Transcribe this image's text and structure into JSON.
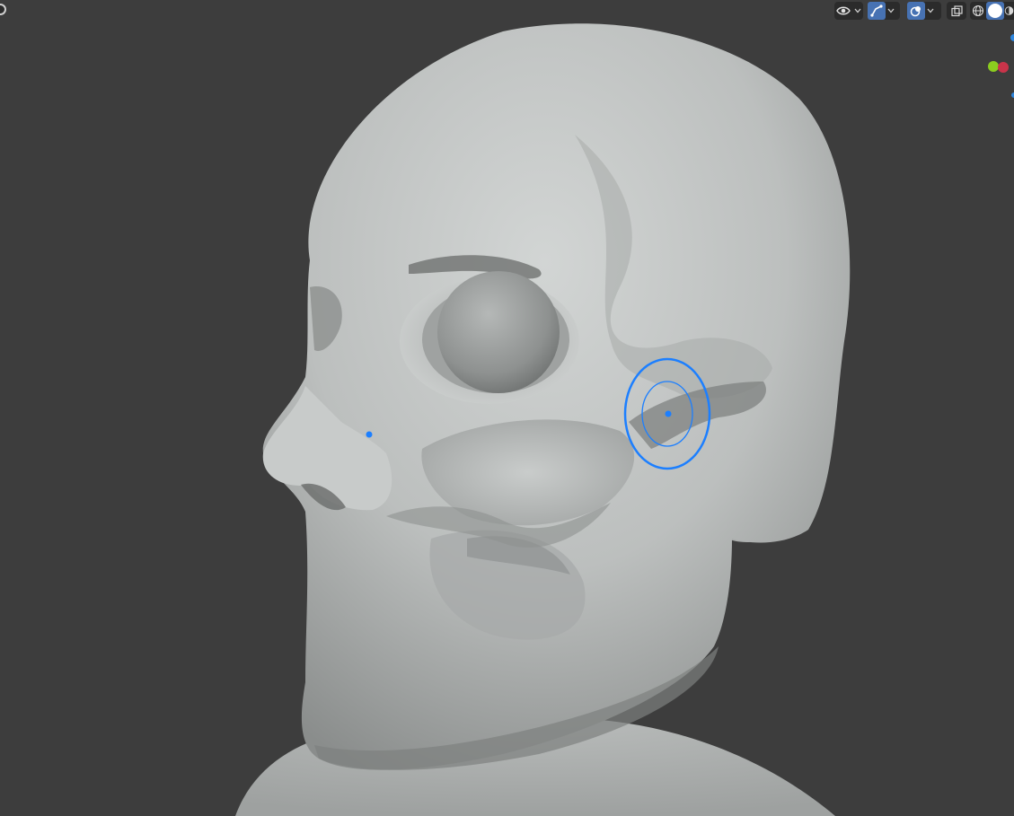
{
  "viewport": {
    "background_color": "#3d3d3d",
    "mesh_color": "#bfc2c2",
    "brush_cursor_color": "#1c7fff"
  },
  "header": {
    "icons": {
      "corner": "editor-type-icon",
      "visibility": "eye-visibility-icon",
      "gizmo": "gizmo-toggle-icon",
      "overlays": "overlays-icon",
      "xray": "xray-toggle-icon",
      "shading_wire": "wireframe-shading-icon",
      "shading_solid": "solid-shading-icon",
      "shading_material": "material-preview-icon"
    },
    "accent_color": "#4772b3"
  },
  "nav_gizmo": {
    "y_axis_color": "#8bcc1f",
    "x_axis_color": "#e23a54",
    "z_axis_color": "#2e86de"
  }
}
